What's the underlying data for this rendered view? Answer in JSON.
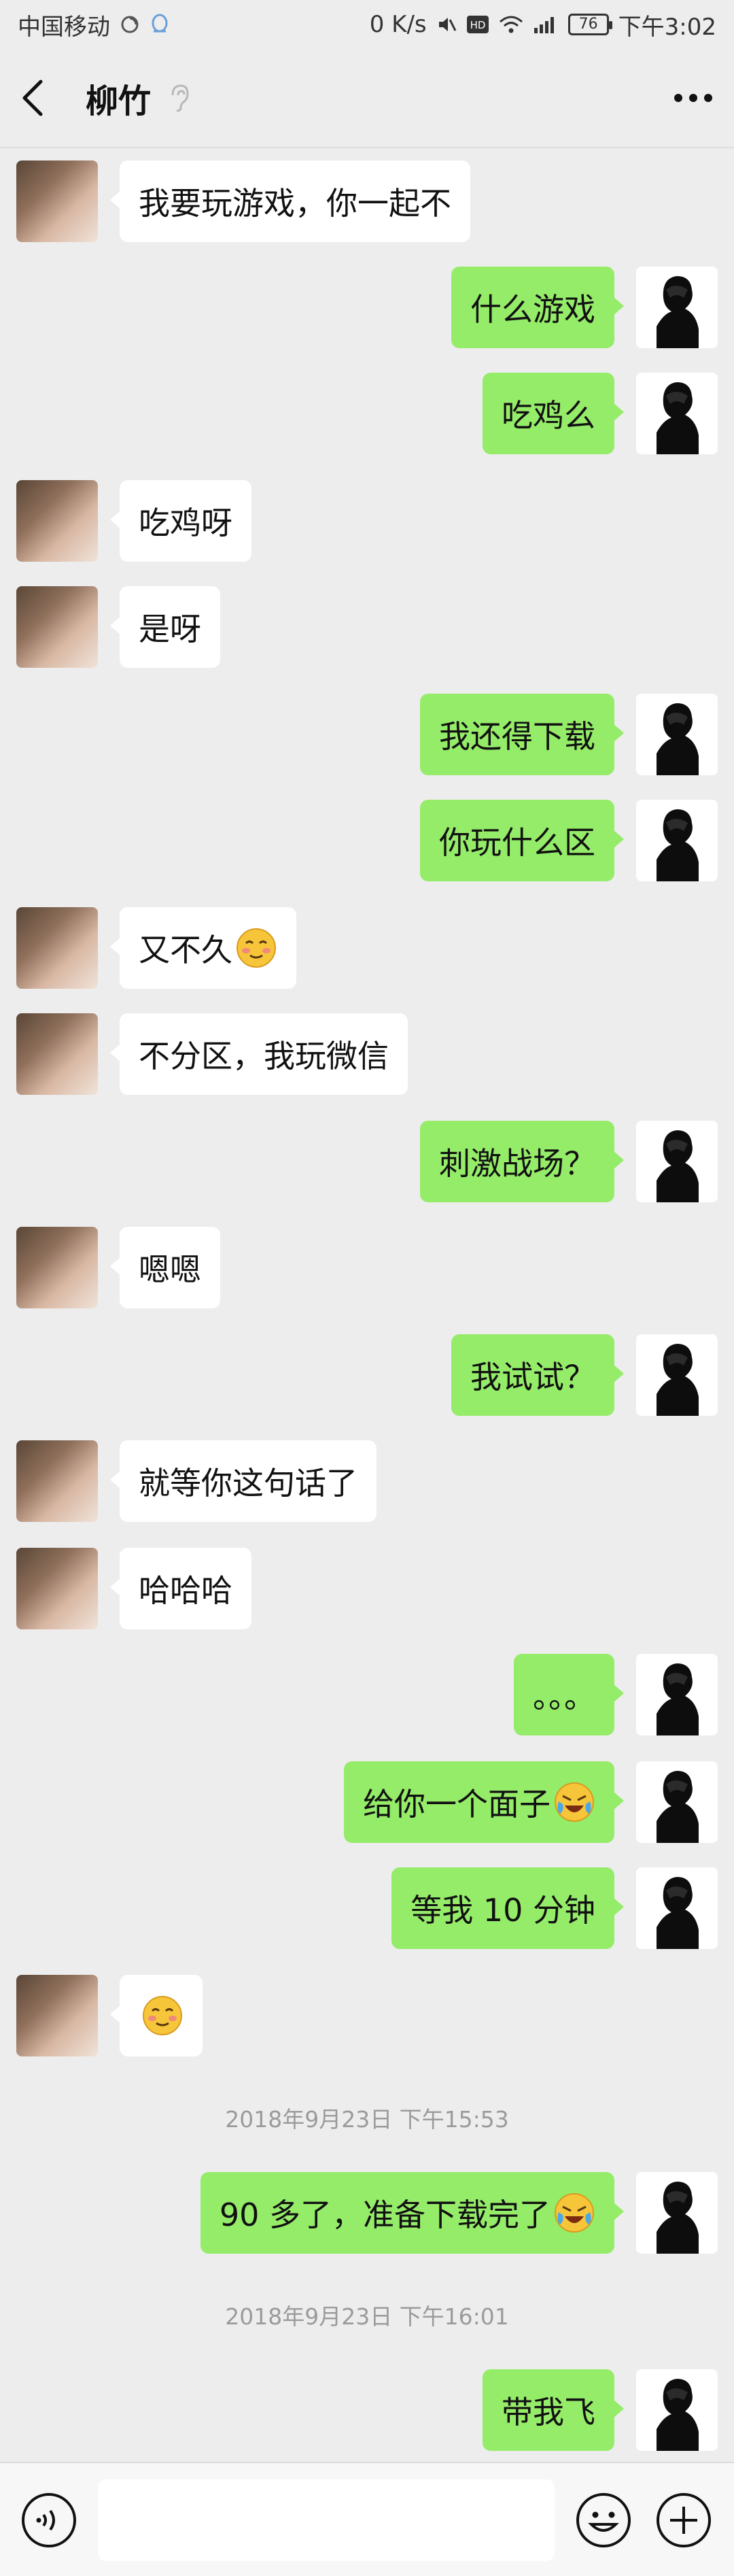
{
  "status": {
    "carrier": "中国移动",
    "speed": "0 K/s",
    "battery": "76",
    "time": "下午3:02"
  },
  "header": {
    "title": "柳竹"
  },
  "messages": [
    {
      "side": "left",
      "text": "我要玩游戏，你一起不"
    },
    {
      "side": "right",
      "text": "什么游戏"
    },
    {
      "side": "right",
      "text": "吃鸡么"
    },
    {
      "side": "left",
      "text": "吃鸡呀"
    },
    {
      "side": "left",
      "text": "是呀"
    },
    {
      "side": "right",
      "text": "我还得下载"
    },
    {
      "side": "right",
      "text": "你玩什么区"
    },
    {
      "side": "left",
      "text": "又不久",
      "emoji": "blush-emoji"
    },
    {
      "side": "left",
      "text": "不分区，我玩微信"
    },
    {
      "side": "right",
      "text": "刺激战场？"
    },
    {
      "side": "left",
      "text": "嗯嗯"
    },
    {
      "side": "right",
      "text": "我试试？"
    },
    {
      "side": "left",
      "text": "就等你这句话了"
    },
    {
      "side": "left",
      "text": "哈哈哈"
    },
    {
      "side": "right",
      "text": "。。。"
    },
    {
      "side": "right",
      "text": "给你一个面子",
      "emoji": "laugh-cry-emoji"
    },
    {
      "side": "right",
      "text": "等我 10 分钟"
    },
    {
      "side": "left",
      "text": "",
      "emoji": "blush-emoji"
    },
    {
      "timestamp": "2018年9月23日 下午15:53"
    },
    {
      "side": "right",
      "text": "90 多了，准备下载完了",
      "emoji": "laugh-cry-emoji"
    },
    {
      "timestamp": "2018年9月23日 下午16:01"
    },
    {
      "side": "right",
      "text": "带我飞"
    }
  ],
  "input": {
    "placeholder": ""
  },
  "colors": {
    "background": "#ededed",
    "bubble_sent": "#95ec69",
    "bubble_received": "#ffffff",
    "timestamp_text": "#9b9b9b"
  },
  "icons": [
    "back-arrow-icon",
    "ear-icon",
    "more-icon",
    "voice-icon",
    "emoji-icon",
    "plus-icon"
  ]
}
